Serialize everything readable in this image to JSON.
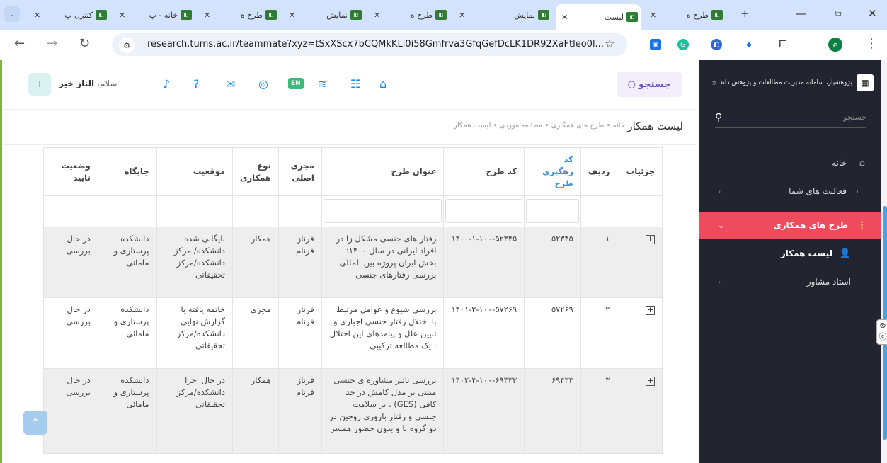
{
  "browser": {
    "tabs": [
      {
        "label": "کنترل پ",
        "favicon": "green-logo"
      },
      {
        "label": "خانه - پ",
        "favicon": "green-logo"
      },
      {
        "label": "طرح ه",
        "favicon": "green-logo"
      },
      {
        "label": "نمایش",
        "favicon": "green-logo"
      },
      {
        "label": "طرح ه",
        "favicon": "green-logo"
      },
      {
        "label": "نمایش",
        "favicon": "green-logo"
      },
      {
        "label": "لیست",
        "favicon": "green-logo",
        "active": true
      },
      {
        "label": "طرح ه",
        "favicon": "green-logo"
      }
    ],
    "url": "research.tums.ac.ir/teammate?xyz=tSxXScx7bCQMkKLi0i58Gmfrva3GfqGefDcLK1DR92XaFtleo0l...",
    "profile_initial": "e",
    "new_tab": "+",
    "close": "✕"
  },
  "header": {
    "search_label": "جستجو",
    "greeting": "سلام،",
    "user_name": "الناز خیر",
    "user_initial": "ا",
    "lang": "EN"
  },
  "sidebar": {
    "brand": "پژوهشیار، سامانه مدیریت مطالعات و پژوهش دانشگاه علوم پزشکی تهران",
    "search_placeholder": "جستجو",
    "items": [
      {
        "label": "خانه"
      },
      {
        "label": "فعالیت های شما"
      },
      {
        "label": "طرح های همکاری"
      },
      {
        "label": "لیست همکار"
      },
      {
        "label": "استاد مشاور"
      }
    ]
  },
  "breadcrumb": {
    "title": "لیست همکار",
    "path": "خانه • طرح های همکاری • مطالعه موردی • لیست همکار"
  },
  "table": {
    "headers": [
      "جزئیات",
      "ردیف",
      "کد رهگیری طرح",
      "کد طرح",
      "عنوان طرح",
      "مجری اصلی",
      "نوع همکاری",
      "موقعیت",
      "جایگاه",
      "وضعیت تایید"
    ],
    "rows": [
      {
        "row": "۱",
        "tracking": "۵۲۳۴۵",
        "code": "۱۴۰۰-۱-۱۰۰-۵۲۳۴۵",
        "title": "رفتار های جنسی مشکل زا در افراد ایرانی در سال ۱۴۰۰: بخش ایران پروژه بین المللی بررسی رفتارهای جنسی",
        "pi": "فرناز فرنام",
        "type": "همکار",
        "position": "بایگانی شده دانشکده/ مرکز دانشکده/مرکز تحقیقاتی",
        "place": "دانشکده پرستاری و مامائی",
        "status": "در حال بررسی"
      },
      {
        "row": "۲",
        "tracking": "۵۷۲۶۹",
        "code": "۱۴۰۱-۲-۱۰۰-۵۷۲۶۹",
        "title": "بررسی شیوع و عوامل مرتبط با اختلال رفتار جنسی اجباری و تبیین علل و پیامدهای این اختلال : یک مطالعه ترکیبی",
        "pi": "فرناز فرنام",
        "type": "مجری",
        "position": "خاتمه یافته با گزارش نهایی دانشکده/مرکز تحقیقاتی",
        "place": "دانشکده پرستاری و مامائی",
        "status": "در حال بررسی"
      },
      {
        "row": "۳",
        "tracking": "۶۹۴۳۳",
        "code": "۱۴۰۲-۴-۱۰۰-۶۹۴۳۳",
        "title": "بررسی تاثیر مشاوره ی جنسی مبتنی بر مدل کامش در حد کافی (GES) ، بر سلامت جنسی و رفتار باروری زوجین در دو گروه با و بدون حضور همسر",
        "pi": "فرناز فرنام",
        "type": "همکار",
        "position": "در حال اجرا دانشکده/مرکز تحقیقاتی",
        "place": "دانشکده پرستاری و مامائی",
        "status": "در حال بررسی"
      }
    ]
  },
  "colors": {
    "accent": "#ef4b5e",
    "sidebar_bg": "#222530",
    "link": "#3b8fd6"
  }
}
